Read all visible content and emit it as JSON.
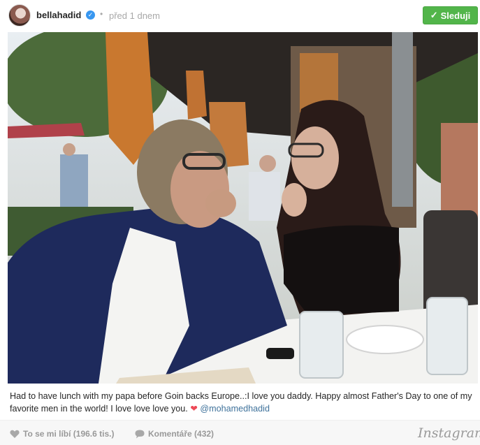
{
  "post": {
    "username": "bellahadid",
    "time_separator": "•",
    "time": "před 1 dnem",
    "follow_label": "Sleduji",
    "caption_text": "Had to have lunch with my papa before Goin backs Europe..:I love you daddy. Happy almost Father's Day to one of my favorite men in the world! I love love love you.",
    "caption_heart": "❤",
    "caption_mention": "@mohamedhadid"
  },
  "footer": {
    "likes_label": "To se mi líbí (196.6 tis.)",
    "comments_label": "Komentáře (432)",
    "logo": "Instagram"
  },
  "colors": {
    "follow_green": "#52b54a",
    "verified_blue": "#3897f0",
    "mention_blue": "#3f729b"
  },
  "icons": [
    "verified-badge-icon",
    "checkmark-icon",
    "heart-icon",
    "comment-bubble-icon"
  ]
}
